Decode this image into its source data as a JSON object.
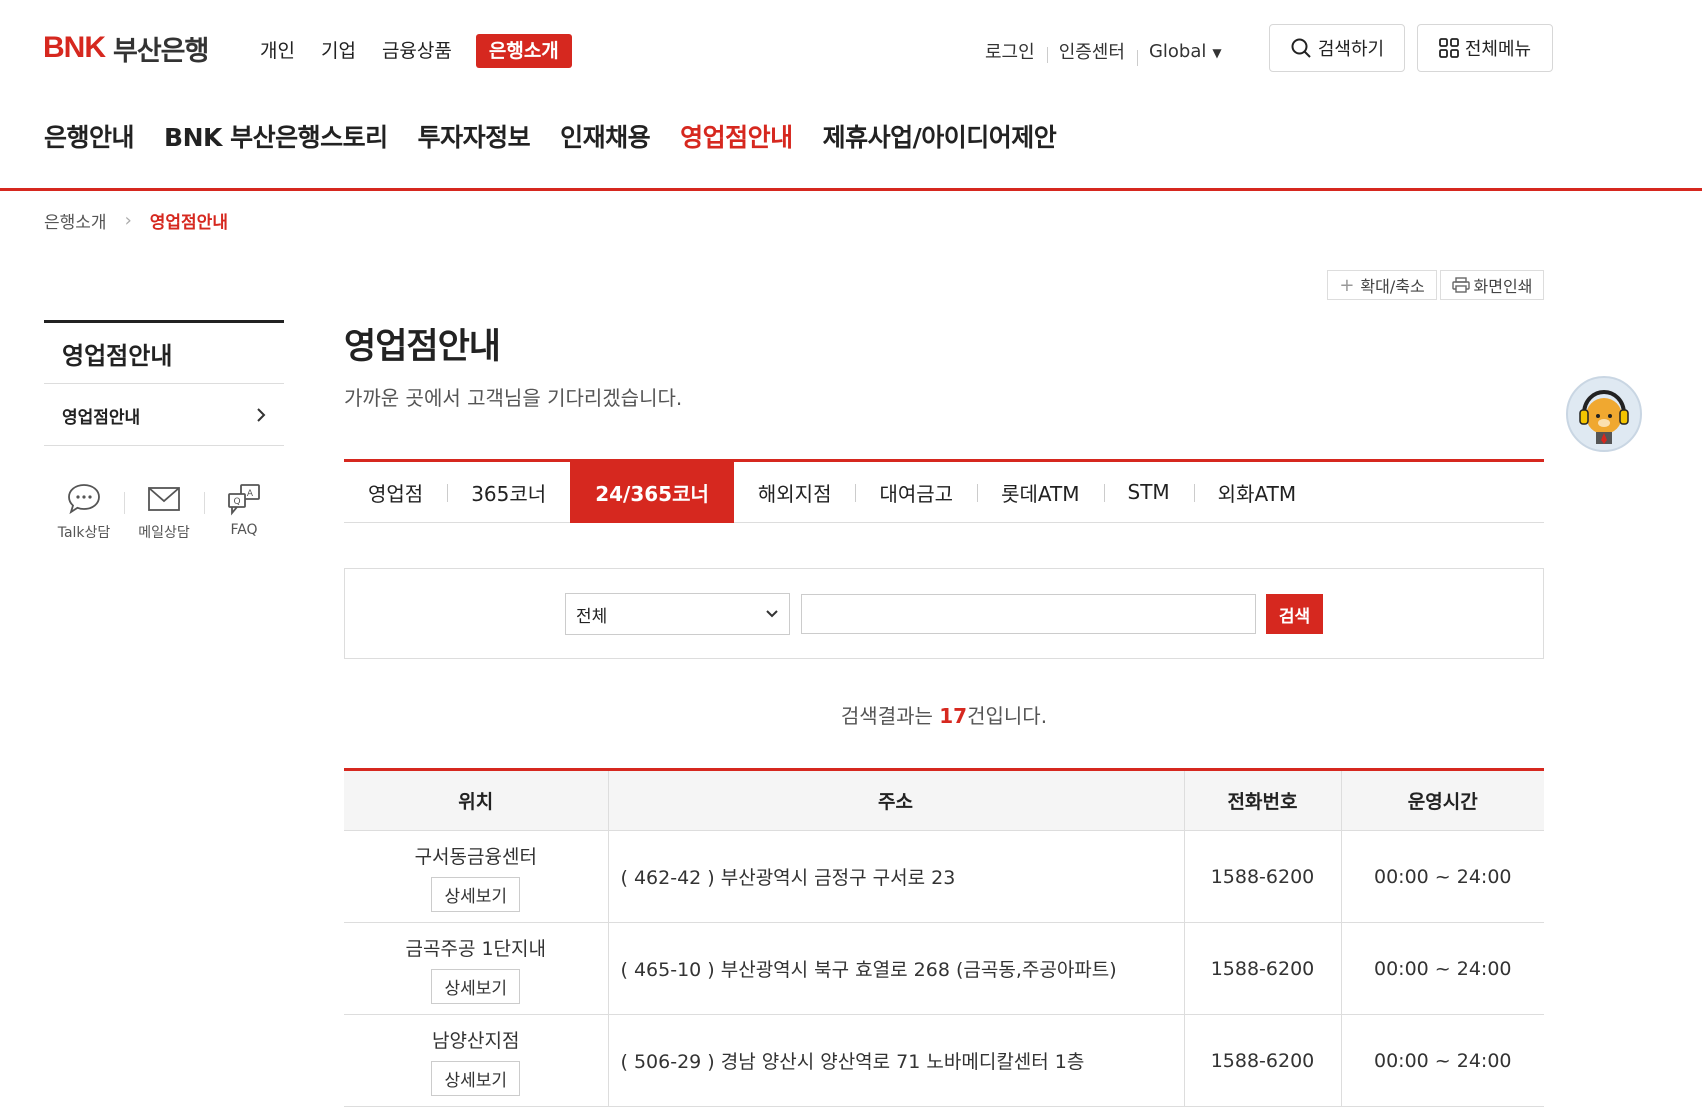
{
  "brand": {
    "logo_mark": "BNK",
    "logo_name": "부산은행"
  },
  "top_nav": [
    "개인",
    "기업",
    "금융상품",
    "은행소개"
  ],
  "top_nav_active": "은행소개",
  "util": {
    "login": "로그인",
    "cert": "인증센터",
    "global": "Global",
    "caret": "▼"
  },
  "buttons": {
    "search": "검색하기",
    "all_menu": "전체메뉴"
  },
  "main_nav": [
    "은행안내",
    "BNK 부산은행스토리",
    "투자자정보",
    "인재채용",
    "영업점안내",
    "제휴사업/아이디어제안"
  ],
  "breadcrumb": {
    "parent": "은행소개",
    "current": "영업점안내"
  },
  "tools": {
    "zoom": "확대/축소",
    "print": "화면인쇄"
  },
  "sidebar": {
    "title": "영업점안내",
    "item": "영업점안내",
    "quick": [
      "Talk상담",
      "메일상담",
      "FAQ"
    ]
  },
  "page": {
    "title": "영업점안내",
    "desc": "가까운 곳에서 고객님을 기다리겠습니다."
  },
  "tabs": [
    "영업점",
    "365코너",
    "24/365코너",
    "해외지점",
    "대여금고",
    "롯데ATM",
    "STM",
    "외화ATM"
  ],
  "tabs_active": "24/365코너",
  "search": {
    "select_value": "전체",
    "input_value": "",
    "button": "검색"
  },
  "result": {
    "prefix": "검색결과는 ",
    "count": "17",
    "suffix": "건입니다."
  },
  "table": {
    "headers": [
      "위치",
      "주소",
      "전화번호",
      "운영시간"
    ],
    "detail_label": "상세보기",
    "rows": [
      {
        "location": "구서동금융센터",
        "address": "( 462-42 ) 부산광역시 금정구 구서로 23",
        "phone": "1588-6200",
        "hours": "00:00 ~ 24:00"
      },
      {
        "location": "금곡주공 1단지내",
        "address": "( 465-10 ) 부산광역시 북구 효열로 268 (금곡동,주공아파트)",
        "phone": "1588-6200",
        "hours": "00:00 ~ 24:00"
      },
      {
        "location": "남양산지점",
        "address": "( 506-29 ) 경남 양산시 양산역로 71 노바메디칼센터 1층",
        "phone": "1588-6200",
        "hours": "00:00 ~ 24:00"
      }
    ]
  },
  "colors": {
    "accent": "#d6281f",
    "header_bg": "#f5f5f5",
    "text": "#222222"
  }
}
